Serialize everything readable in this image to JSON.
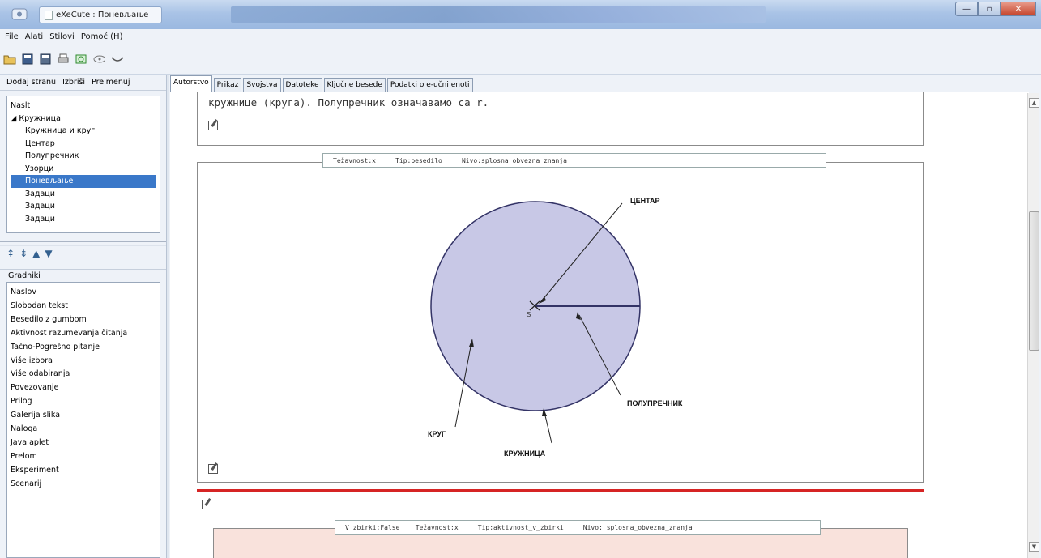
{
  "window": {
    "title": "eXeCute : Поневљање",
    "controls": {
      "minimize": "—",
      "maximize": "▫",
      "close": "✕"
    }
  },
  "menu": {
    "items": [
      "File",
      "Alati",
      "Stilovi",
      "Pomoć (H)"
    ]
  },
  "toolbar": {
    "icons": [
      "open-folder-icon",
      "save-icon",
      "save-as-icon",
      "print-icon",
      "preview-icon",
      "eye-icon",
      "smile-icon"
    ]
  },
  "left_panel": {
    "page_actions": [
      "Dodaj stranu",
      "Izbriši",
      "Preimenuj"
    ],
    "tree": [
      {
        "label": "Naslt",
        "level": 1
      },
      {
        "label": "◢ Кружница",
        "level": 1
      },
      {
        "label": "Кружница и круг",
        "level": 2
      },
      {
        "label": "Центар",
        "level": 2
      },
      {
        "label": "Полупречник",
        "level": 2
      },
      {
        "label": "Узорци",
        "level": 2
      },
      {
        "label": "Поневљање",
        "level": 2,
        "selected": true
      },
      {
        "label": "Задаци",
        "level": 2
      },
      {
        "label": "Задаци",
        "level": 2
      },
      {
        "label": "Задаци",
        "level": 2
      }
    ],
    "arrows": [
      "⇞",
      "⇟",
      "▲",
      "▼"
    ],
    "gradniki_label": "Gradniki",
    "gradniki": [
      "Naslov",
      "Slobodan tekst",
      "Besedilo z gumbom",
      "Aktivnost razumevanja čitanja",
      "Tačno-Pogrešno pitanje",
      "Više izbora",
      "Više odabiranja",
      "Povezovanje",
      "Prilog",
      "Galerija slika",
      "Naloga",
      "Java aplet",
      "Prelom",
      "Eksperiment",
      "Scenarij"
    ]
  },
  "tabs": [
    "Autorstvo",
    "Prikaz",
    "Svojstva",
    "Datoteke",
    "Ključne besede",
    "Podatki o e-učni enoti"
  ],
  "content": {
    "paragraph": "кружнице (круга). Полупречник означавамо са r.",
    "box2_meta": "Težavnost:x     Tip:besedilo     Nivo:splosna_obvezna_znanja",
    "box3_meta": "V zbirki:False    Težavnost:x     Tip:aktivnost_v_zbirki     Nivo: splosna_obvezna_znanja",
    "diagram": {
      "center_label": "S",
      "labels": {
        "centar": "ЦЕНТАР",
        "poluprecnik": "ПОЛУПРЕЧНИК",
        "krug": "КРУГ",
        "kruznica": "КРУЖНИЦА"
      },
      "fill_color": "#c8c8e6",
      "stroke_color": "#333366"
    }
  },
  "colors": {
    "accent_selection": "#3a78c9",
    "divider_red": "#d62424",
    "box3_fill": "#f9e2dc"
  }
}
